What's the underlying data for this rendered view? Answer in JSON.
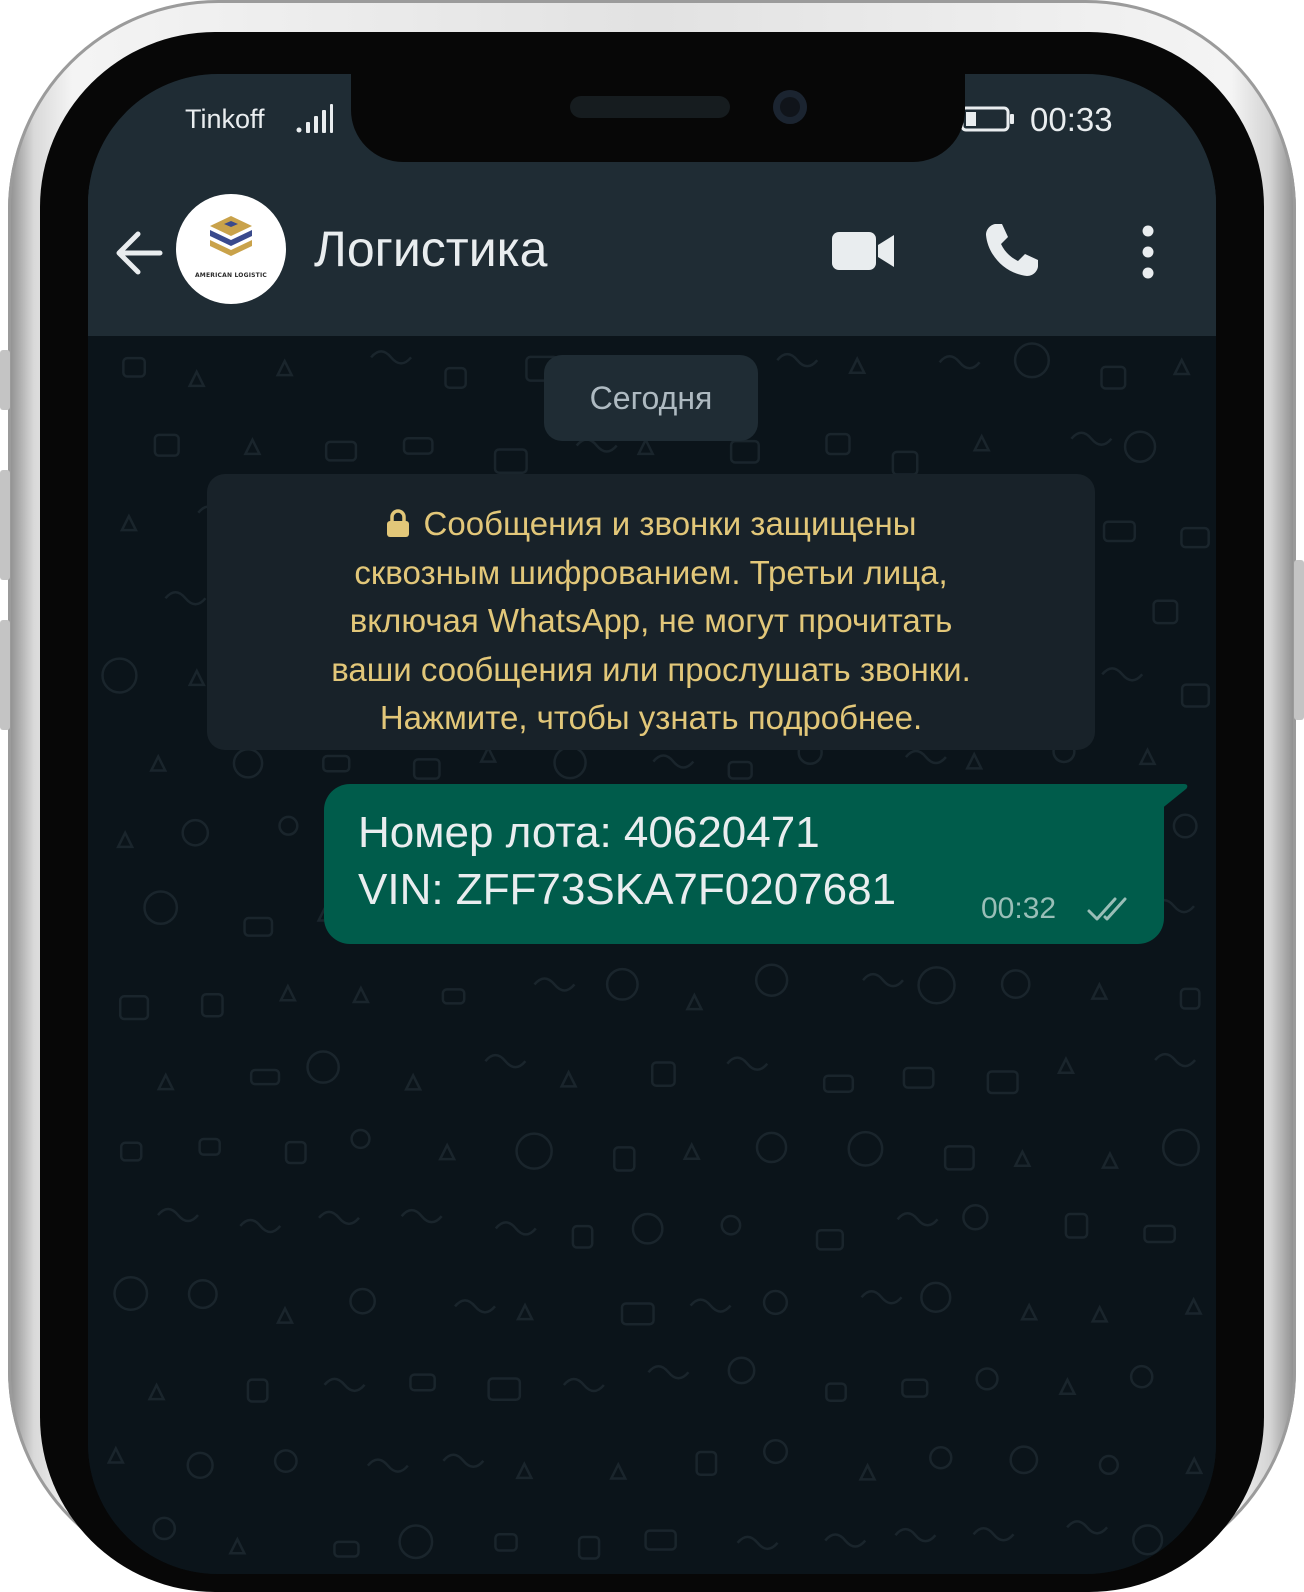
{
  "status_bar": {
    "carrier": "Tinkoff",
    "time": "00:33",
    "signal_icon": "signal-bars-icon",
    "battery_icon": "battery-icon"
  },
  "header": {
    "title": "Логистика",
    "avatar_text": "AMERICAN LOGISTIC",
    "back_icon": "arrow-left-icon",
    "video_icon": "videocam-icon",
    "call_icon": "phone-icon",
    "menu_icon": "more-vertical-icon"
  },
  "chat": {
    "date_chip": "Сегодня",
    "encryption_notice": {
      "lines": [
        "Сообщения и звонки защищены",
        "сквозным шифрованием. Третьи лица,",
        "включая WhatsApp, не могут прочитать",
        "ваши сообщения или прослушать звонки.",
        "Нажмите, чтобы узнать подробнее."
      ],
      "icon": "lock-icon"
    },
    "messages": [
      {
        "direction": "outgoing",
        "lines": [
          "Номер лота: 40620471",
          "VIN: ZFF73SKA7F0207681"
        ],
        "time": "00:32",
        "status": "read"
      }
    ]
  },
  "colors": {
    "header_bg": "#1f2c34",
    "chat_bg": "#0b141a",
    "outgoing_bubble": "#005c4b",
    "notice_bg": "#182229",
    "notice_text": "#e2c779",
    "primary_text": "#e9edef",
    "secondary_text": "#aebac1"
  }
}
